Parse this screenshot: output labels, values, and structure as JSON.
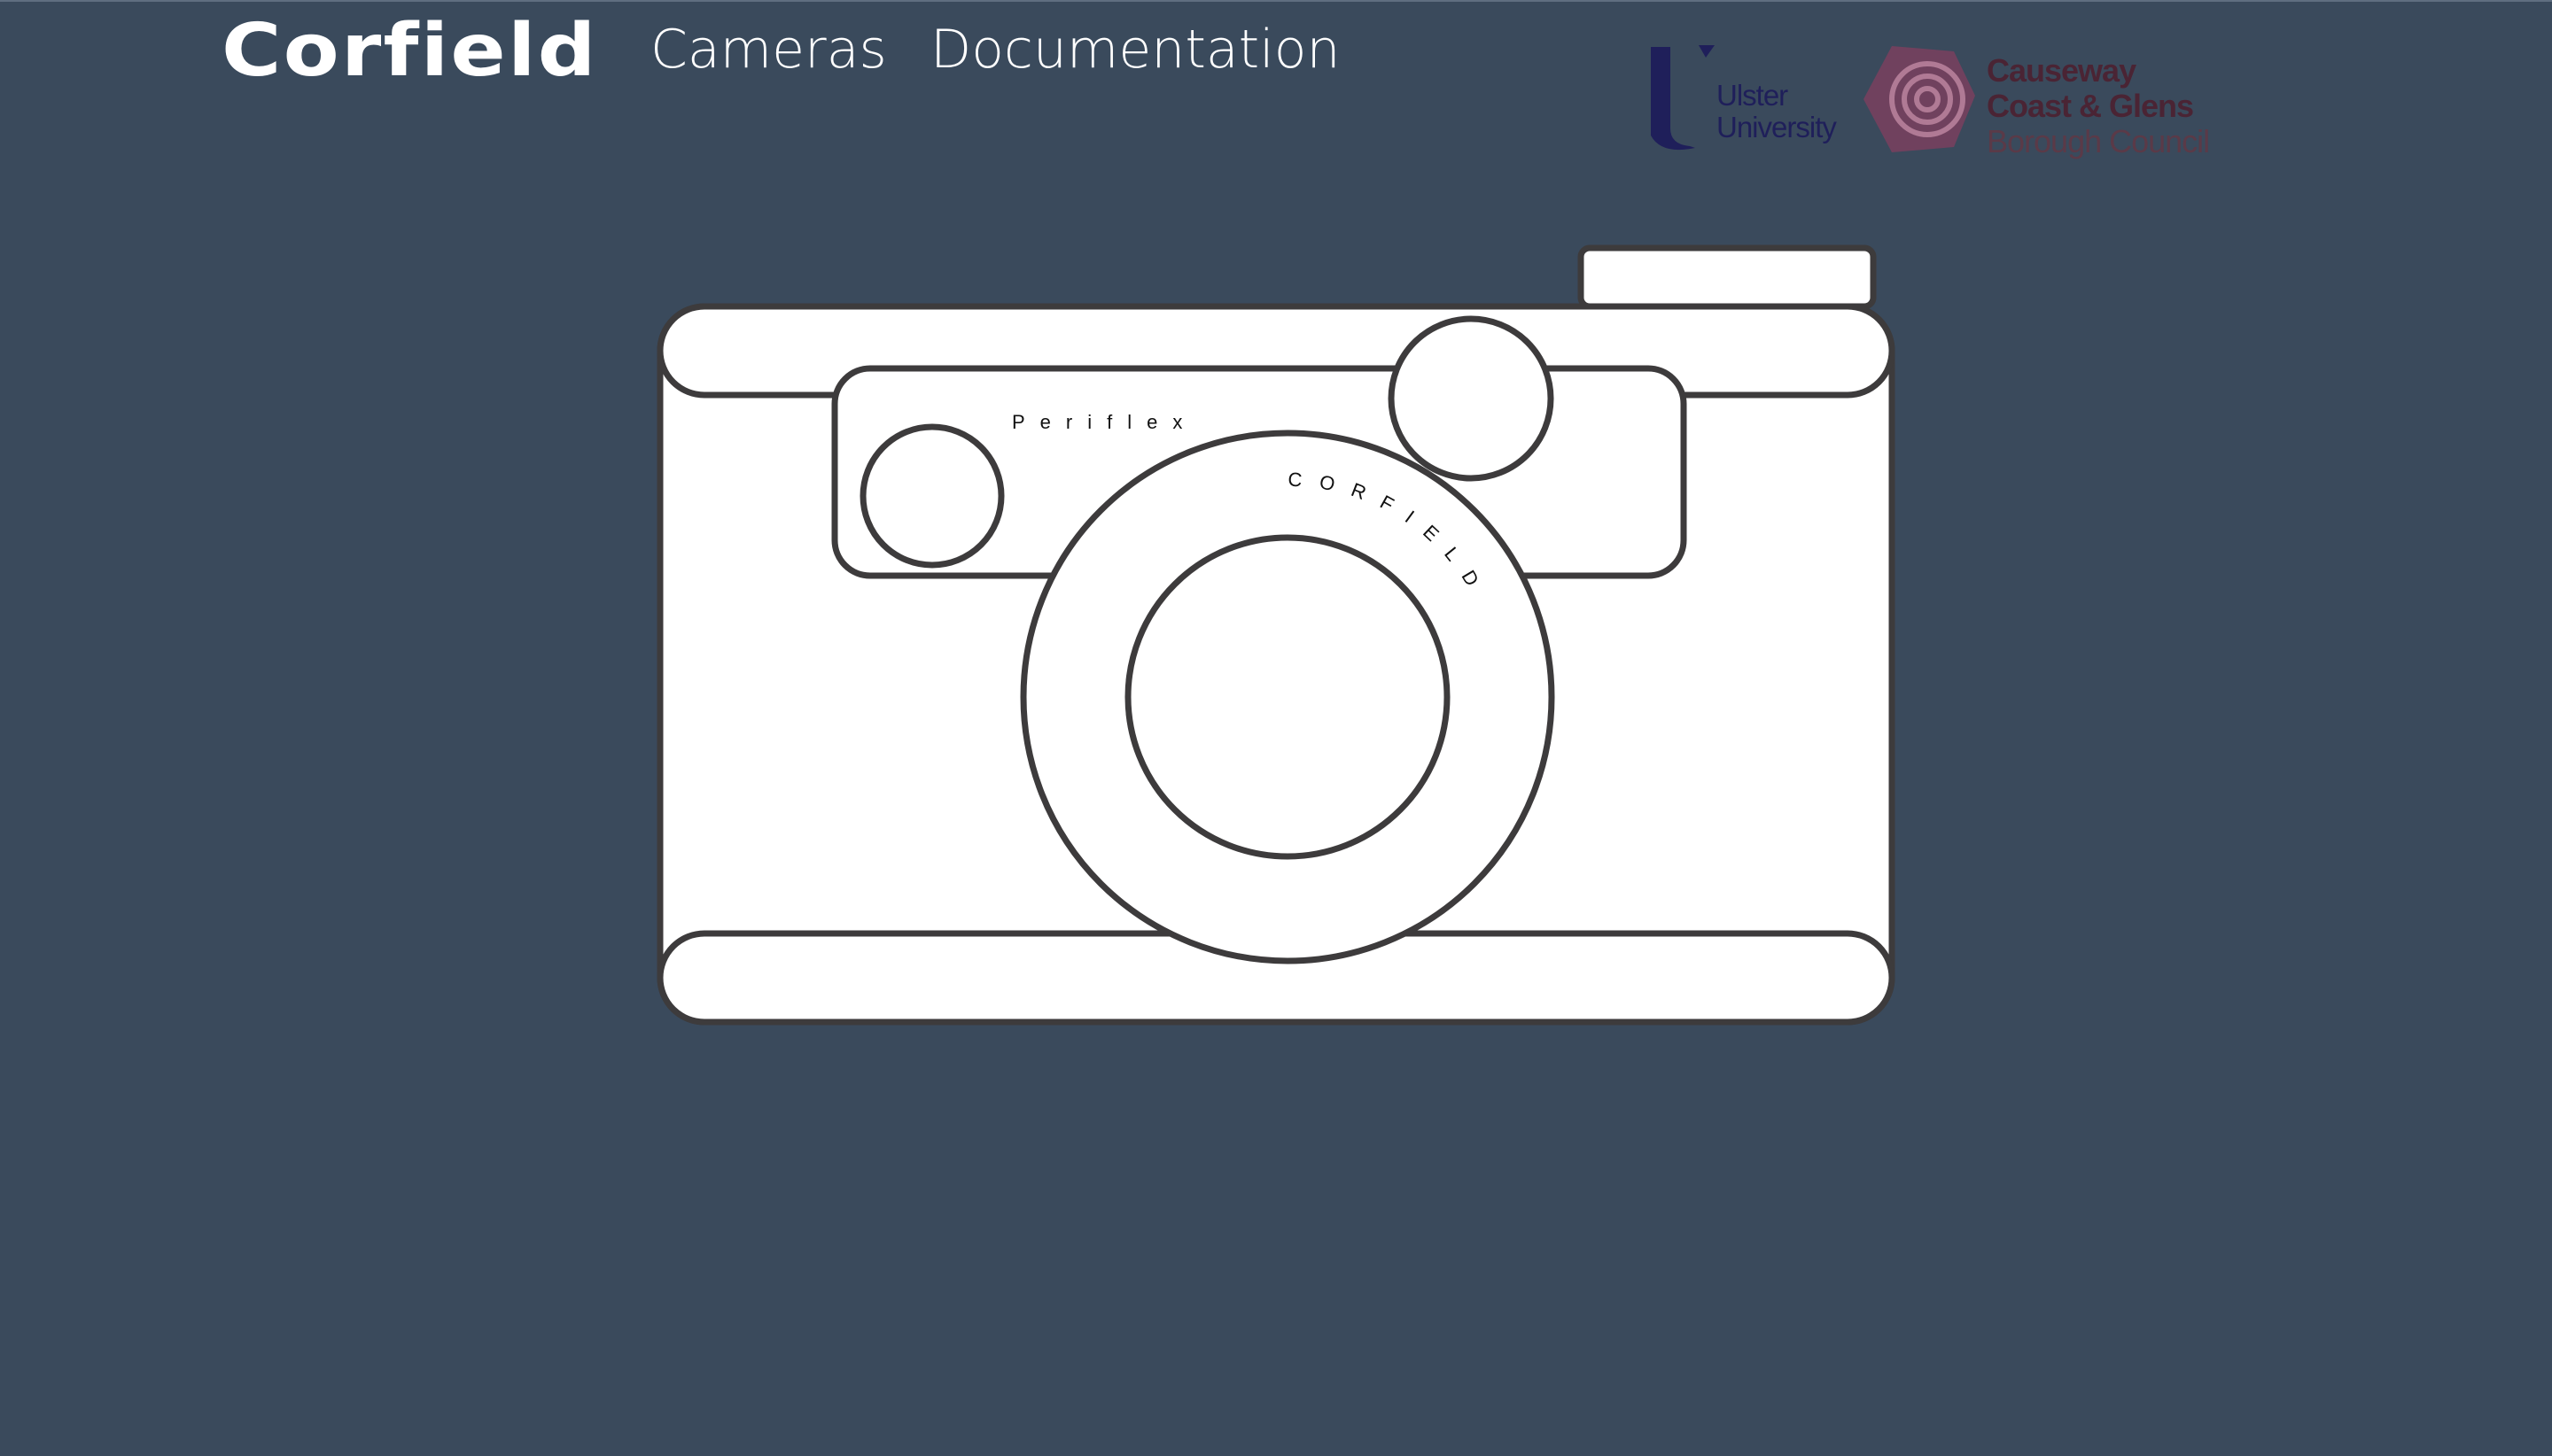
{
  "header": {
    "brand": "Corfield",
    "nav": [
      {
        "label": "Cameras"
      },
      {
        "label": "Documentation"
      }
    ]
  },
  "partners": {
    "ulster": {
      "line1": "Ulster",
      "line2": "University",
      "color": "#1f1f5a"
    },
    "council": {
      "line1": "Causeway",
      "line2": "Coast & Glens",
      "line3": "Borough Council",
      "color": "#6e3650"
    }
  },
  "camera": {
    "model_label": "Periflex",
    "lens_label": "CORFIELD"
  },
  "colors": {
    "background": "#3a4a5c",
    "camera_fill": "#ffffff",
    "camera_stroke": "#3d3b3c"
  }
}
